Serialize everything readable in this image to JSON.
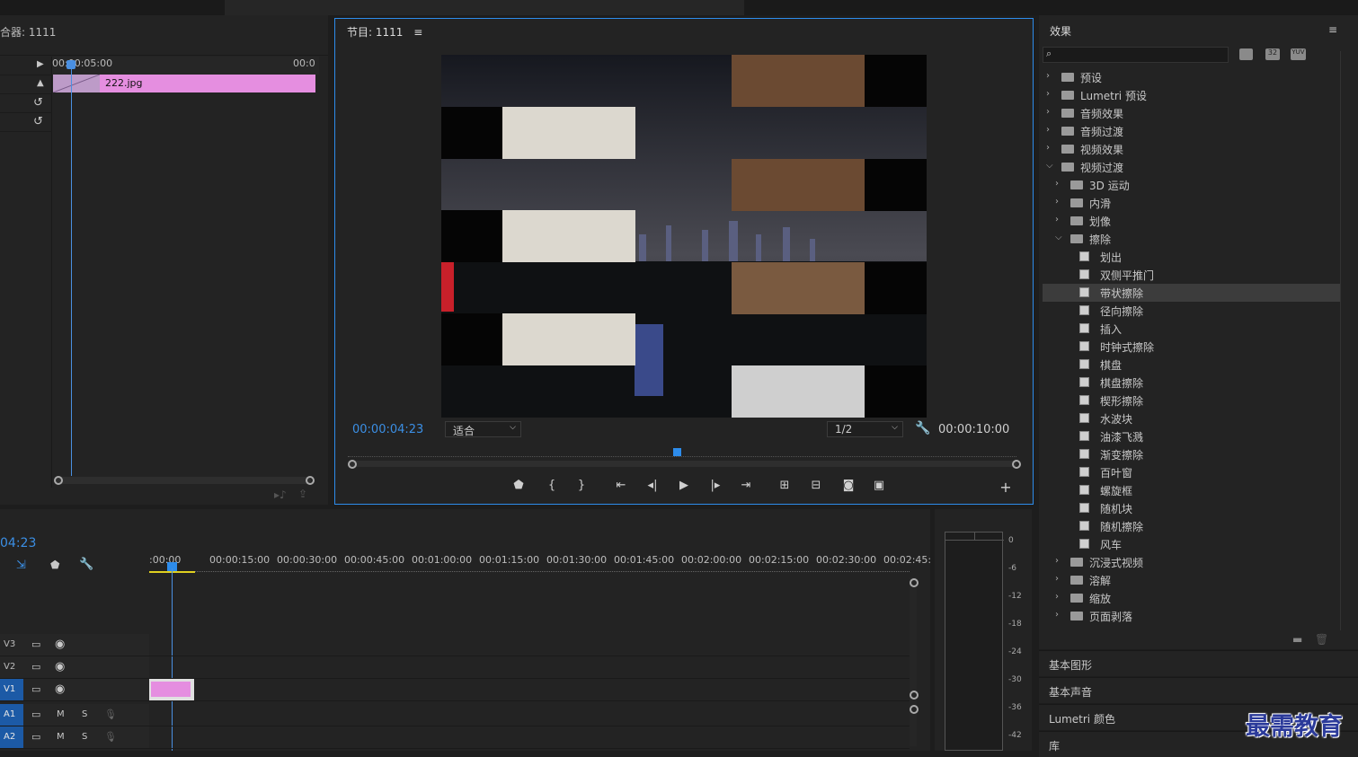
{
  "top_bar": {},
  "effect_controls": {
    "title": "合器: 1111",
    "ruler_time": "00:00:05:00",
    "ruler_time_end": "00:0",
    "clip_name": "222.jpg"
  },
  "program_monitor": {
    "title": "节目: 1111",
    "menu_glyph": "≡",
    "current_time": "00:00:04:23",
    "fit_option": "适合",
    "resolution": "1/2",
    "duration": "00:00:10:00",
    "accent_color": "#2d8ceb"
  },
  "effects_panel": {
    "title": "效果",
    "menu_glyph": "≡",
    "badges": [
      "32",
      "YUV"
    ],
    "items": [
      {
        "label": "预设",
        "kind": "folder",
        "level": 0,
        "expanded": false
      },
      {
        "label": "Lumetri 预设",
        "kind": "folder",
        "level": 0,
        "expanded": false
      },
      {
        "label": "音频效果",
        "kind": "folder",
        "level": 0,
        "expanded": false
      },
      {
        "label": "音频过渡",
        "kind": "folder",
        "level": 0,
        "expanded": false
      },
      {
        "label": "视频效果",
        "kind": "folder",
        "level": 0,
        "expanded": false
      },
      {
        "label": "视频过渡",
        "kind": "folder",
        "level": 0,
        "expanded": true
      },
      {
        "label": "3D 运动",
        "kind": "folder",
        "level": 1,
        "expanded": false
      },
      {
        "label": "内滑",
        "kind": "folder",
        "level": 1,
        "expanded": false
      },
      {
        "label": "划像",
        "kind": "folder",
        "level": 1,
        "expanded": false
      },
      {
        "label": "擦除",
        "kind": "folder",
        "level": 1,
        "expanded": true
      },
      {
        "label": "划出",
        "kind": "effect",
        "level": 2
      },
      {
        "label": "双侧平推门",
        "kind": "effect",
        "level": 2
      },
      {
        "label": "带状擦除",
        "kind": "effect",
        "level": 2,
        "selected": true
      },
      {
        "label": "径向擦除",
        "kind": "effect",
        "level": 2
      },
      {
        "label": "插入",
        "kind": "effect",
        "level": 2
      },
      {
        "label": "时钟式擦除",
        "kind": "effect",
        "level": 2
      },
      {
        "label": "棋盘",
        "kind": "effect",
        "level": 2
      },
      {
        "label": "棋盘擦除",
        "kind": "effect",
        "level": 2
      },
      {
        "label": "楔形擦除",
        "kind": "effect",
        "level": 2
      },
      {
        "label": "水波块",
        "kind": "effect",
        "level": 2
      },
      {
        "label": "油漆飞溅",
        "kind": "effect",
        "level": 2
      },
      {
        "label": "渐变擦除",
        "kind": "effect",
        "level": 2
      },
      {
        "label": "百叶窗",
        "kind": "effect",
        "level": 2
      },
      {
        "label": "螺旋框",
        "kind": "effect",
        "level": 2
      },
      {
        "label": "随机块",
        "kind": "effect",
        "level": 2
      },
      {
        "label": "随机擦除",
        "kind": "effect",
        "level": 2
      },
      {
        "label": "风车",
        "kind": "effect",
        "level": 2
      },
      {
        "label": "沉浸式视频",
        "kind": "folder",
        "level": 1,
        "expanded": false
      },
      {
        "label": "溶解",
        "kind": "folder",
        "level": 1,
        "expanded": false
      },
      {
        "label": "缩放",
        "kind": "folder",
        "level": 1,
        "expanded": false
      },
      {
        "label": "页面剥落",
        "kind": "folder",
        "level": 1,
        "expanded": false
      }
    ],
    "side_panels": [
      "基本图形",
      "基本声音",
      "Lumetri 颜色",
      "库"
    ]
  },
  "timeline": {
    "current_time": "04:23",
    "ticks": [
      ":00:00",
      "00:00:15:00",
      "00:00:30:00",
      "00:00:45:00",
      "00:01:00:00",
      "00:01:15:00",
      "00:01:30:00",
      "00:01:45:00",
      "00:02:00:00",
      "00:02:15:00",
      "00:02:30:00",
      "00:02:45:"
    ],
    "tracks": [
      {
        "name": "V3",
        "type": "video",
        "active": false
      },
      {
        "name": "V2",
        "type": "video",
        "active": false
      },
      {
        "name": "V1",
        "type": "video",
        "active": true
      },
      {
        "name": "A1",
        "type": "audio",
        "active": true,
        "mute": "M",
        "solo": "S"
      },
      {
        "name": "A2",
        "type": "audio",
        "active": true,
        "mute": "M",
        "solo": "S"
      }
    ],
    "clip_color": "#e58ee0"
  },
  "audio_meter": {
    "scale": [
      "0",
      "-6",
      "-12",
      "-18",
      "-24",
      "-30",
      "-36",
      "-42"
    ]
  },
  "watermark": {
    "text": "最需教育"
  }
}
